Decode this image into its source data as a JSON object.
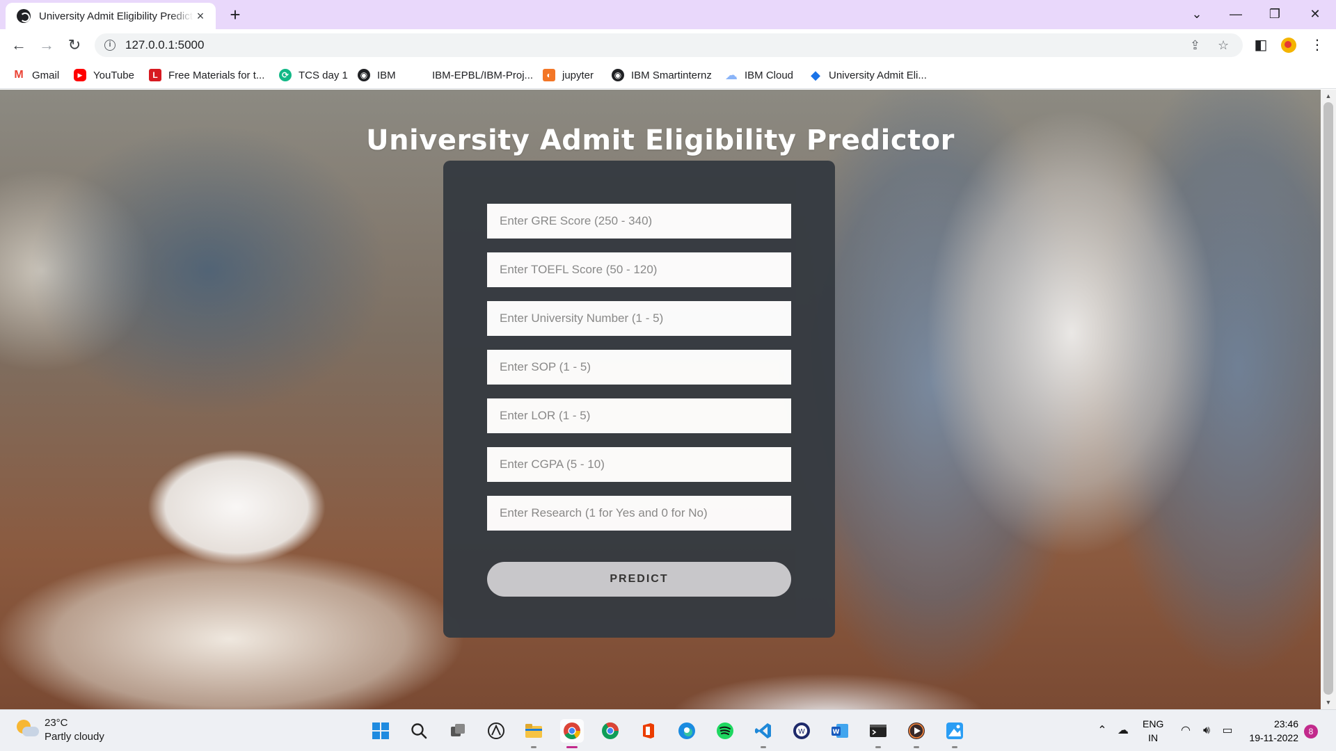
{
  "browser": {
    "tab_title": "University Admit Eligibility Predictor",
    "tab_close_icon": "×",
    "new_tab_icon": "+",
    "window_controls": {
      "tab_search": "⌄",
      "minimize": "—",
      "restore": "❐",
      "close": "✕"
    },
    "nav": {
      "back": "←",
      "forward": "→",
      "reload": "↻"
    },
    "url": "127.0.0.1:5000",
    "accent_tabstrip": "#e9d8fb"
  },
  "bookmarks": [
    {
      "label": "Gmail",
      "icon": "gmail-icon",
      "color": "#ea4335",
      "glyph": "M"
    },
    {
      "label": "YouTube",
      "icon": "youtube-icon",
      "color": "#ff0000",
      "glyph": "▶"
    },
    {
      "label": "Free Materials for t...",
      "icon": "l-logo-icon",
      "color": "#d71a21",
      "glyph": "L"
    },
    {
      "label": "TCS day 1",
      "icon": "tcs-icon",
      "color": "#12b886",
      "glyph": "⟳"
    },
    {
      "label": "IBM",
      "icon": "globe-icon",
      "color": "#202124",
      "glyph": "◉"
    },
    {
      "label": "IBM-EPBL/IBM-Proj...",
      "icon": "blank-icon",
      "color": "transparent",
      "glyph": ""
    },
    {
      "label": "jupyter",
      "icon": "jupyter-icon",
      "color": "#f37626",
      "glyph": "◐"
    },
    {
      "label": "IBM Smartinternz",
      "icon": "globe-icon",
      "color": "#202124",
      "glyph": "◉"
    },
    {
      "label": "IBM Cloud",
      "icon": "cloud-icon",
      "color": "#8ab4f8",
      "glyph": "☁"
    },
    {
      "label": "University Admit Eli...",
      "icon": "diamond-icon",
      "color": "#1a73e8",
      "glyph": "◆"
    }
  ],
  "page": {
    "title": "University Admit Eligibility Predictor",
    "fields": [
      {
        "name": "gre-score-input",
        "placeholder": "Enter GRE Score (250 - 340)"
      },
      {
        "name": "toefl-score-input",
        "placeholder": "Enter TOEFL Score (50 - 120)"
      },
      {
        "name": "university-number-input",
        "placeholder": "Enter University Number (1 - 5)"
      },
      {
        "name": "sop-input",
        "placeholder": "Enter SOP (1 - 5)"
      },
      {
        "name": "lor-input",
        "placeholder": "Enter LOR (1 - 5)"
      },
      {
        "name": "cgpa-input",
        "placeholder": "Enter CGPA (5 - 10)"
      },
      {
        "name": "research-input",
        "placeholder": "Enter Research (1 for Yes and 0 for No)"
      }
    ],
    "button_label": "PREDICT",
    "card_color": "#363b41",
    "button_color": "#cbcbcf"
  },
  "taskbar": {
    "weather": {
      "temp": "23°C",
      "condition": "Partly cloudy"
    },
    "apps": [
      {
        "name": "start-icon",
        "running": false
      },
      {
        "name": "search-icon",
        "running": false
      },
      {
        "name": "task-view-icon",
        "running": false
      },
      {
        "name": "widgets-icon",
        "running": false
      },
      {
        "name": "file-explorer-icon",
        "running": true
      },
      {
        "name": "chrome-icon",
        "running": true,
        "active": true
      },
      {
        "name": "chrome-profile-icon",
        "running": false
      },
      {
        "name": "office-icon",
        "running": false
      },
      {
        "name": "edge-icon",
        "running": false
      },
      {
        "name": "spotify-icon",
        "running": false
      },
      {
        "name": "vscode-icon",
        "running": true
      },
      {
        "name": "wps-icon",
        "running": false
      },
      {
        "name": "word-icon",
        "running": false
      },
      {
        "name": "terminal-icon",
        "running": true
      },
      {
        "name": "media-player-icon",
        "running": true
      },
      {
        "name": "paint-icon",
        "running": true
      }
    ],
    "tray": {
      "lang_line1": "ENG",
      "lang_line2": "IN",
      "time": "23:46",
      "date": "19-11-2022",
      "notifications": "8"
    }
  }
}
